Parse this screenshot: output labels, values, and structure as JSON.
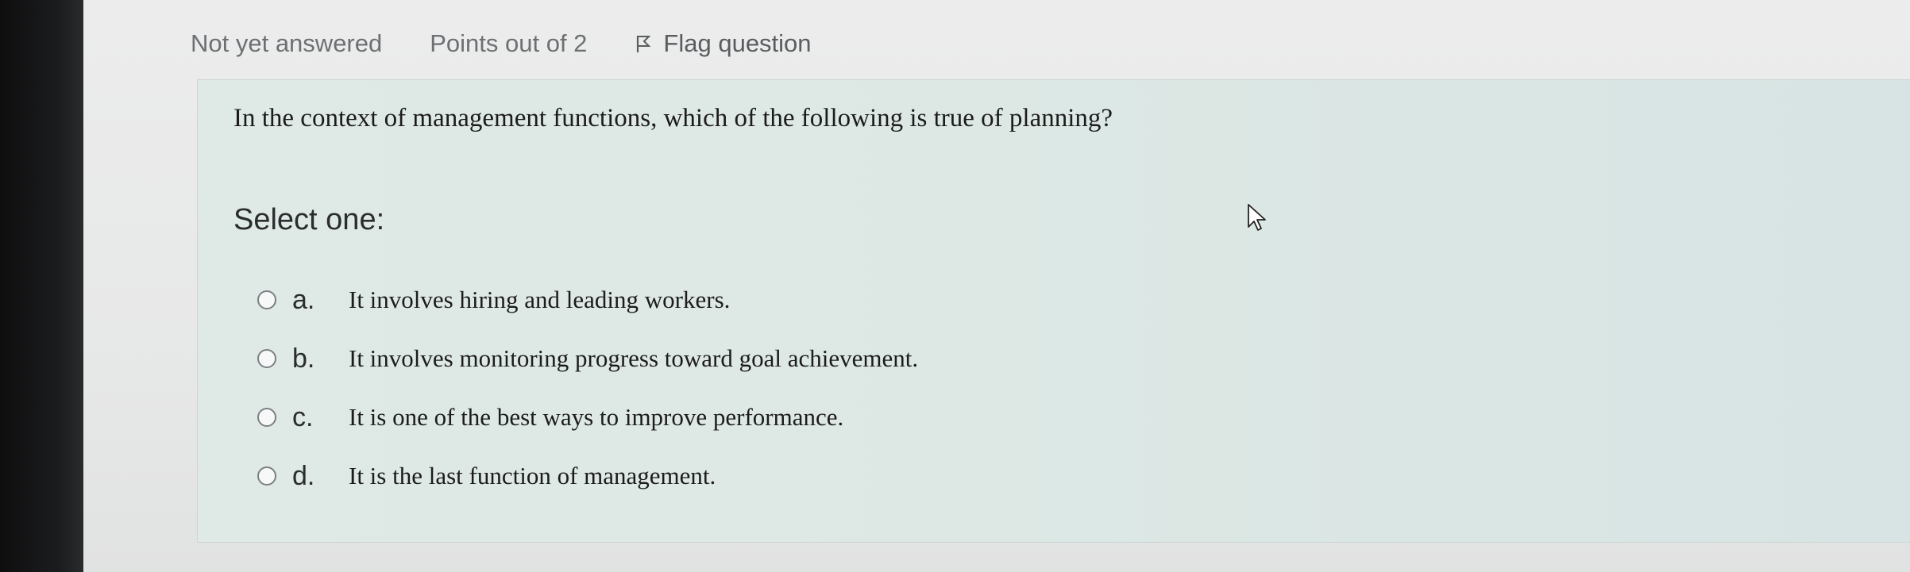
{
  "question_info": {
    "state": "Not yet answered",
    "grade": "Points out of 2",
    "flag_label": "Flag question",
    "flag_icon": "flag-icon"
  },
  "question": {
    "text": "In the context of management functions, which of the following is true of planning?",
    "prompt": "Select one:"
  },
  "answers": [
    {
      "letter": "a.",
      "text": "It involves hiring and leading workers.",
      "selected": false
    },
    {
      "letter": "b.",
      "text": "It involves monitoring progress toward goal achievement.",
      "selected": false
    },
    {
      "letter": "c.",
      "text": "It is one of the best ways to improve performance.",
      "selected": false
    },
    {
      "letter": "d.",
      "text": "It is the last function of management.",
      "selected": false
    }
  ],
  "cursor_icon": "mouse-pointer-icon"
}
